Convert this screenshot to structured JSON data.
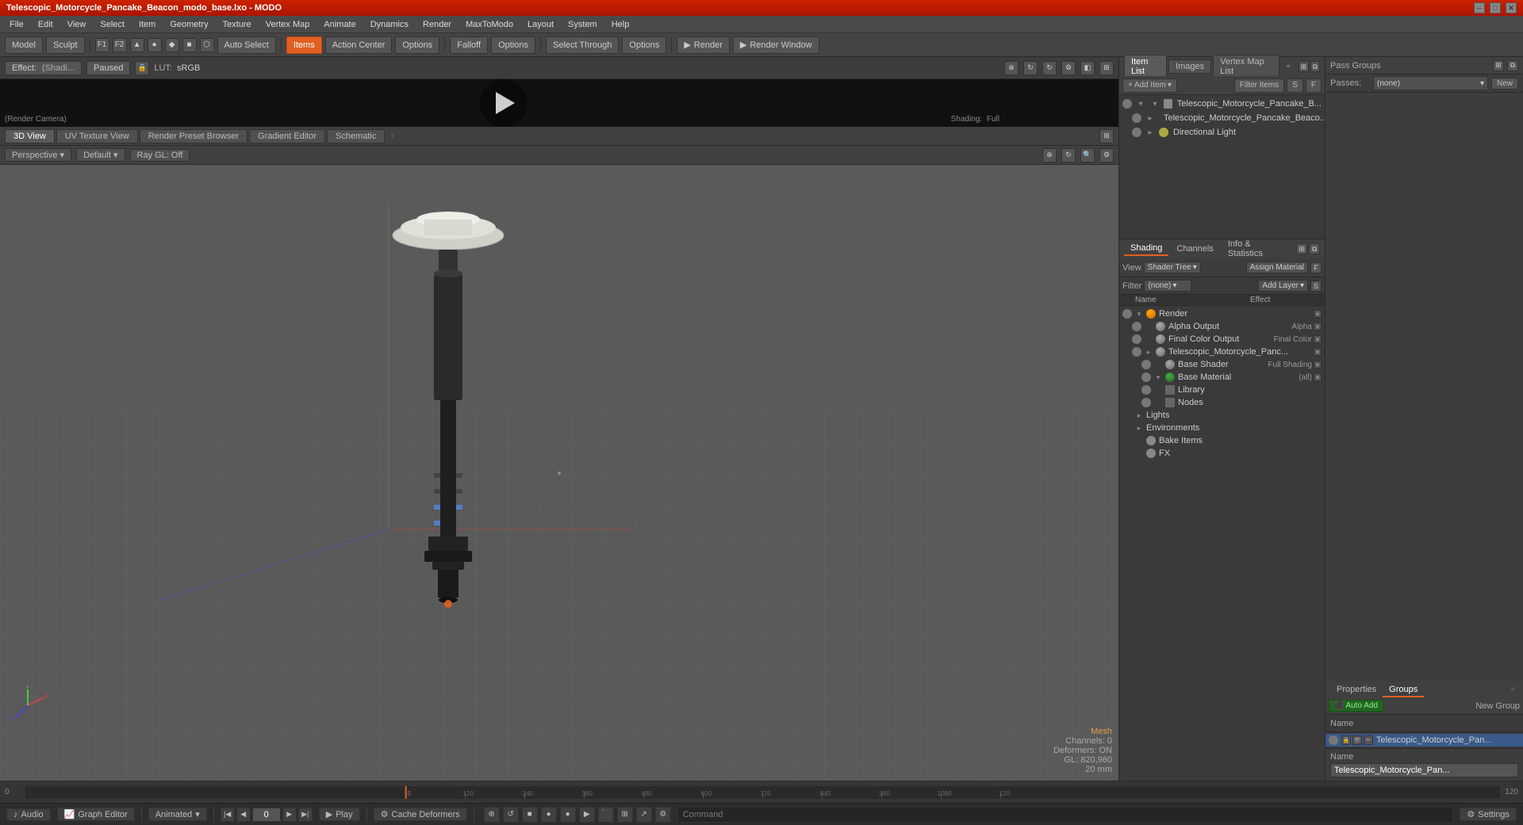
{
  "window": {
    "title": "Telescopic_Motorcycle_Pancake_Beacon_modo_base.lxo - MODO"
  },
  "menu": {
    "items": [
      "File",
      "Edit",
      "View",
      "Select",
      "Item",
      "Geometry",
      "Texture",
      "Vertex Map",
      "Animate",
      "Dynamics",
      "Render",
      "MaxToModo",
      "Layout",
      "System",
      "Help"
    ]
  },
  "toolbar": {
    "model_btn": "Model",
    "sculpt_btn": "Sculpt",
    "f1": "F1",
    "f2": "F2",
    "auto_select": "Auto Select",
    "items_btn": "Items",
    "action_center_btn": "Action Center",
    "options1": "Options",
    "falloff_btn": "Falloff",
    "options2": "Options",
    "select_through": "Select Through",
    "options3": "Options",
    "render_btn": "Render",
    "render_window_btn": "Render Window"
  },
  "render_controls": {
    "effect_label": "Effect:",
    "effect_value": "(Shadi...",
    "paused_btn": "Paused",
    "lut_label": "LUT:",
    "lut_value": "sRGB",
    "camera_btn": "(Render Camera)",
    "shading_label": "Shading:",
    "shading_value": "Full"
  },
  "viewport_tabs": {
    "tabs": [
      "3D View",
      "UV Texture View",
      "Render Preset Browser",
      "Gradient Editor",
      "Schematic"
    ],
    "active": "3D View"
  },
  "viewport": {
    "perspective": "Perspective",
    "default_btn": "Default",
    "ray_gl": "Ray GL: Off",
    "mesh_label": "Mesh",
    "channels": "Channels: 0",
    "deformers": "Deformers: ON",
    "gl_size": "GL: 820,960",
    "unit": "20 mm"
  },
  "item_list": {
    "tabs": [
      "Item List",
      "Images",
      "Vertex Map List"
    ],
    "active": "Item List",
    "add_item_btn": "Add Item",
    "filter_label": "Filter Items",
    "toolbar_icons": [
      "plus",
      "minus",
      "settings"
    ],
    "items": [
      {
        "name": "Telescopic_Motorcycle_Pancake_B...",
        "indent": 0,
        "expanded": true,
        "type": "mesh"
      },
      {
        "name": "Telescopic_Motorcycle_Pancake_Beaco...",
        "indent": 1,
        "expanded": false,
        "type": "mesh"
      },
      {
        "name": "Directional Light",
        "indent": 1,
        "expanded": false,
        "type": "light"
      }
    ]
  },
  "shading": {
    "tabs": [
      "Shading",
      "Channels",
      "Info & Statistics"
    ],
    "active": "Shading",
    "view_label": "View",
    "view_value": "Shader Tree",
    "assign_material": "Assign Material",
    "filter_label": "Filter",
    "filter_value": "(none)",
    "add_layer": "Add Layer",
    "tree_items": [
      {
        "name": "Render",
        "indent": 0,
        "expanded": true,
        "type": "orange",
        "effect": ""
      },
      {
        "name": "Alpha Output",
        "indent": 1,
        "expanded": false,
        "type": "gray",
        "effect": "Alpha"
      },
      {
        "name": "Final Color Output",
        "indent": 1,
        "expanded": false,
        "type": "gray",
        "effect": "Final Color"
      },
      {
        "name": "Telescopic_Motorcycle_Panc...",
        "indent": 1,
        "expanded": true,
        "type": "gray",
        "effect": ""
      },
      {
        "name": "Base Shader",
        "indent": 2,
        "expanded": false,
        "type": "gray",
        "effect": "Full Shading"
      },
      {
        "name": "Base Material",
        "indent": 2,
        "expanded": false,
        "type": "green",
        "effect": "(all)"
      },
      {
        "name": "Library",
        "indent": 2,
        "expanded": false,
        "type": "none",
        "effect": ""
      },
      {
        "name": "Nodes",
        "indent": 2,
        "expanded": false,
        "type": "none",
        "effect": ""
      },
      {
        "name": "Lights",
        "indent": 0,
        "expanded": false,
        "type": "none",
        "effect": ""
      },
      {
        "name": "Environments",
        "indent": 0,
        "expanded": false,
        "type": "none",
        "effect": ""
      },
      {
        "name": "Bake Items",
        "indent": 0,
        "expanded": false,
        "type": "none",
        "effect": ""
      },
      {
        "name": "FX",
        "indent": 0,
        "expanded": false,
        "type": "none",
        "effect": ""
      }
    ]
  },
  "pass_groups": {
    "pass_label": "Pass Groups",
    "passes_label": "Passes:",
    "passes_value": "(none)",
    "new_btn": "New"
  },
  "groups": {
    "tabs": [
      "Properties",
      "Groups"
    ],
    "active": "Groups",
    "auto_add_btn": "Auto Add",
    "new_group_label": "New Group",
    "name_label": "Name",
    "header_label": "Name",
    "items": [
      {
        "name": "Telescopic_Motorcycle_Pan...",
        "selected": true
      }
    ],
    "name_value": "Telescopic_Motorcycle_Pan..."
  },
  "timeline": {
    "marks": [
      "0",
      "120",
      "240",
      "360",
      "480",
      "600",
      "720",
      "840",
      "960",
      "1080",
      "120"
    ],
    "current_frame": "0",
    "end_frame": "120"
  },
  "status_bar": {
    "audio_btn": "Audio",
    "graph_editor_btn": "Graph Editor",
    "animated_btn": "Animated",
    "play_btn": "Play",
    "cache_deformers_btn": "Cache Deformers",
    "settings_btn": "Settings",
    "command_label": "Command",
    "current_frame": "0"
  }
}
